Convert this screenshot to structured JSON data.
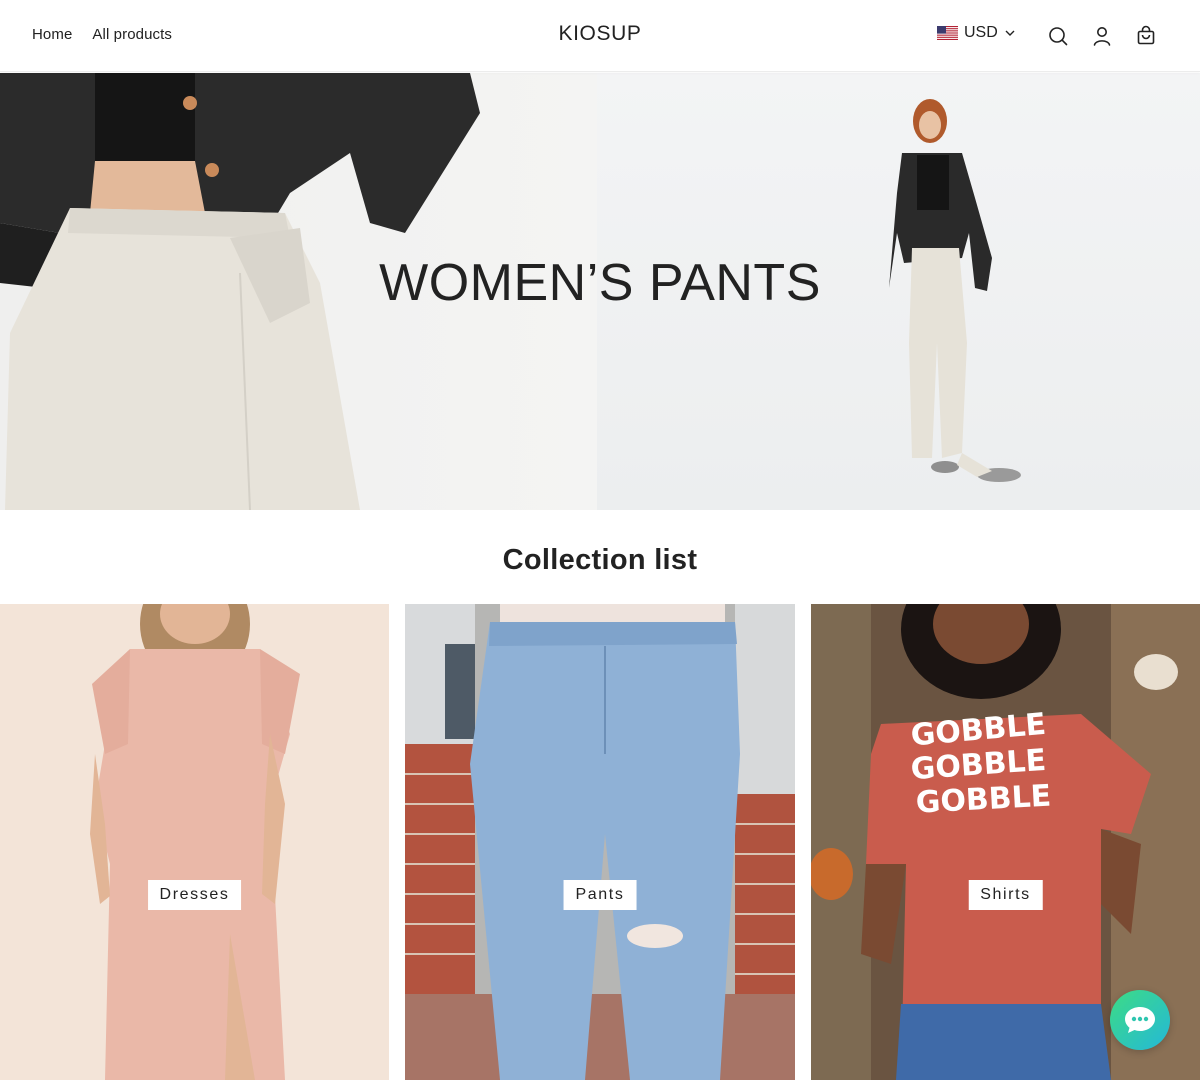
{
  "header": {
    "nav": [
      {
        "label": "Home"
      },
      {
        "label": "All products"
      }
    ],
    "logo": "KIOSUP",
    "currency": {
      "flag_icon": "us-flag-icon",
      "code": "USD",
      "dropdown_icon": "chevron-down-icon"
    },
    "icons": [
      "search-icon",
      "account-icon",
      "cart-icon"
    ]
  },
  "hero": {
    "title": "WOMEN’S PANTS"
  },
  "collection": {
    "title": "Collection list",
    "items": [
      {
        "label": "Dresses"
      },
      {
        "label": "Pants"
      },
      {
        "label": "Shirts"
      }
    ]
  },
  "chat": {
    "icon": "chat-bubble-icon"
  },
  "colors": {
    "text": "#222222",
    "background": "#ffffff",
    "chat_gradient_start": "#3ddc84",
    "chat_gradient_end": "#24b8d8"
  }
}
